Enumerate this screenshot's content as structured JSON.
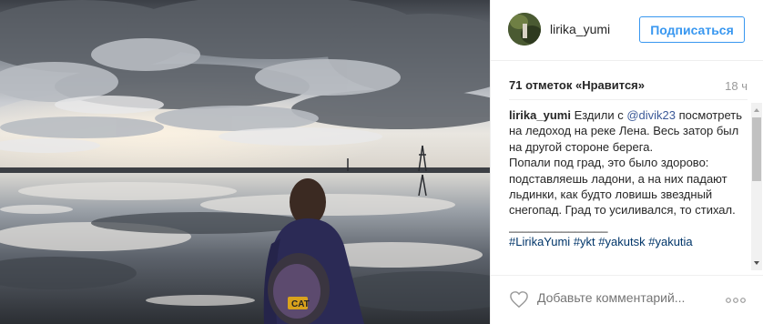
{
  "post": {
    "username": "lirika_yumi",
    "follow_label": "Подписаться",
    "likes": "71 отметок «Нравится»",
    "time": "18 ч",
    "caption_user": "lirika_yumi",
    "caption_text_1": "Ездили с ",
    "caption_mention": "@divik23",
    "caption_text_2": " посмотреть на ледоход на реке Лена. Весь затор был на другой стороне берега.",
    "caption_text_3": "Попали под град, это было здорово: подставляешь ладони, а на них падают льдинки, как будто ловишь звездный снегопад. Град то усиливался, то стихал.",
    "caption_separator": "_______________",
    "hashtags": [
      "#LirikaYumi",
      "#ykt",
      "#yakutsk",
      "#yakutia"
    ]
  },
  "comment_box": {
    "placeholder": "Добавьте комментарий..."
  },
  "icons": {
    "heart": "heart-icon",
    "more": "more-options-icon",
    "scroll_up": "scroll-up-arrow-icon",
    "scroll_down": "scroll-down-arrow-icon"
  },
  "colors": {
    "accent": "#3897f0",
    "mention": "#3b5998",
    "hashtag": "#003569",
    "muted": "#999999"
  }
}
